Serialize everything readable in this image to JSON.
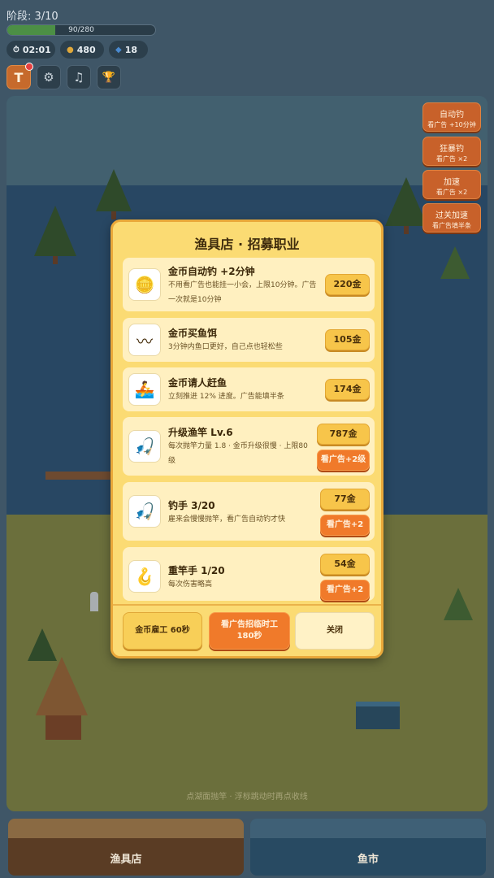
{
  "hud": {
    "stage": "阶段: 3/10",
    "progress_text": "90/280",
    "progress_value": 90,
    "progress_max": 280,
    "timer": "02:01",
    "coins": "480",
    "fish": "18",
    "timer_icon": "stopwatch-icon",
    "coin_icon": "coin-icon",
    "fish_icon": "fish-icon"
  },
  "toolbar": [
    {
      "icon": "t-badge-icon",
      "glyph": "T"
    },
    {
      "icon": "gear-icon",
      "glyph": "⚙"
    },
    {
      "icon": "music-icon",
      "glyph": "♫"
    },
    {
      "icon": "trophy-icon",
      "glyph": "🏆"
    }
  ],
  "side_buttons": [
    {
      "title": "自动钓",
      "sub": "看广告 +10分钟"
    },
    {
      "title": "狂暴钓",
      "sub": "看广告 ×2"
    },
    {
      "title": "加速",
      "sub": "看广告 ×2"
    },
    {
      "title": "过关加速",
      "sub": "看广告填半条"
    }
  ],
  "scene_hint": "点湖面抛竿 · 浮标跳动时再点收线",
  "modal": {
    "title": "渔具店 · 招募职业",
    "items": [
      {
        "icon": "gold-coin-icon",
        "glyph": "🪙",
        "name": "金币自动钓 +2分钟",
        "desc": "不用看广告也能挂一小会，上限10分钟。广告一次就是10分钟",
        "price": "220金"
      },
      {
        "icon": "worm-bait-icon",
        "glyph": "〰",
        "name": "金币买鱼饵",
        "desc": "3分钟内鱼口更好，自己点也轻松些",
        "price": "105金"
      },
      {
        "icon": "boat-helper-icon",
        "glyph": "🚣",
        "name": "金币请人赶鱼",
        "desc": "立刻推进 12% 进度。广告能填半条",
        "price": "174金"
      },
      {
        "icon": "fishing-rod-icon",
        "glyph": "🎣",
        "name": "升级渔竿 Lv.6",
        "desc": "每次抛竿力量 1.8 · 金币升级很慢 · 上限80级",
        "price": "787金",
        "ad": "看广告+2级"
      },
      {
        "icon": "fisher-hand-icon",
        "glyph": "🎣",
        "name": "钓手 3/20",
        "desc": "雇来会慢慢抛竿，看广告自动钓才快",
        "price": "77金",
        "ad": "看广告+2"
      },
      {
        "icon": "hook-icon",
        "glyph": "🪝",
        "name": "重竿手 1/20",
        "desc": "每次伤害略高",
        "price": "54金",
        "ad": "看广告+2"
      }
    ],
    "footer": {
      "hire": "金币雇工 60秒",
      "ad_line1": "看广告招临时工",
      "ad_line2": "180秒",
      "close": "关闭"
    }
  },
  "tabs": {
    "shop": "渔具店",
    "market": "鱼市"
  },
  "colors": {
    "modal_bg": "#fbdb73",
    "price_button": "#f7c54a",
    "ad_button": "#f07a2a",
    "side_button": "#c8612a"
  }
}
